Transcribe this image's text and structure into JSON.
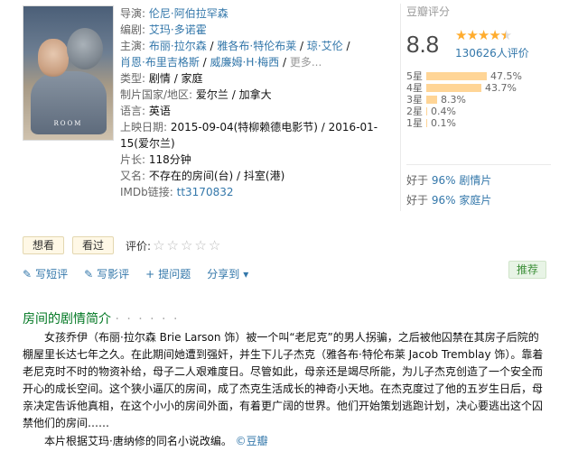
{
  "poster": {
    "title_text": "ROOM"
  },
  "info": {
    "director": {
      "label": "导演:",
      "values": [
        "伦尼·阿伯拉罕森"
      ]
    },
    "writer": {
      "label": "编剧:",
      "values": [
        "艾玛·多诺霍"
      ]
    },
    "cast": {
      "label": "主演:",
      "line1": [
        "布丽·拉尔森",
        "雅各布·特伦布莱",
        "琼·艾伦"
      ],
      "line2": [
        "肖恩·布里吉格斯",
        "威廉姆·H·梅西"
      ],
      "more": "更多..."
    },
    "genre": {
      "label": "类型:",
      "value": "剧情 / 家庭"
    },
    "country": {
      "label": "制片国家/地区:",
      "value": "爱尔兰 / 加拿大"
    },
    "language": {
      "label": "语言:",
      "value": "英语"
    },
    "release": {
      "label": "上映日期:",
      "value": "2015-09-04(特柳赖德电影节) / 2016-01-15(爱尔兰)"
    },
    "runtime": {
      "label": "片长:",
      "value": "118分钟"
    },
    "aka": {
      "label": "又名:",
      "value": "不存在的房间(台) / 抖室(港)"
    },
    "imdb": {
      "label": "IMDb链接:",
      "value": "tt3170832"
    }
  },
  "rating": {
    "title": "豆瓣评分",
    "score": "8.8",
    "stars_value": 4.5,
    "votes": "130626人评价",
    "distribution": [
      {
        "label": "5星",
        "percent": 47.5,
        "text": "47.5%"
      },
      {
        "label": "4星",
        "percent": 43.7,
        "text": "43.7%"
      },
      {
        "label": "3星",
        "percent": 8.3,
        "text": "8.3%"
      },
      {
        "label": "2星",
        "percent": 0.4,
        "text": "0.4%"
      },
      {
        "label": "1星",
        "percent": 0.1,
        "text": "0.1%"
      }
    ],
    "better_than": [
      {
        "prefix": "好于",
        "pct": "96%",
        "genre": "剧情片"
      },
      {
        "prefix": "好于",
        "pct": "96%",
        "genre": "家庭片"
      }
    ],
    "star_color": "#ffac2d",
    "bar_color": "#ffd596"
  },
  "actions": {
    "want": "想看",
    "seen": "看过",
    "rate_label": "评价:"
  },
  "ops": {
    "short_review": "写短评",
    "long_review": "写影评",
    "question": "提问题",
    "share": "分享到",
    "recommend": "推荐"
  },
  "summary": {
    "title": "房间的剧情简介",
    "dots": "· · · · · ·",
    "text": "女孩乔伊（布丽·拉尔森 Brie Larson 饰）被一个叫“老尼克”的男人拐骗，之后被他囚禁在其房子后院的棚屋里长达七年之久。在此期间她遭到强奸，并生下儿子杰克（雅各布·特伦布莱 Jacob Tremblay 饰）。靠着老尼克时不时的物资补给，母子二人艰难度日。尽管如此，母亲还是竭尽所能，为儿子杰克创造了一个安全而开心的成长空间。这个狭小逼仄的房间，成了杰克生活成长的神奇小天地。在杰克度过了他的五岁生日后，母亲决定告诉他真相，在这个小小的房间外面，有着更广阔的世界。他们开始策划逃跑计划，决心要逃出这个囚禁他们的房间……",
    "note_prefix": "本片根据艾玛·唐纳修的同名小说改编。",
    "note_source": "©豆瓣"
  },
  "colors": {
    "link": "#3377aa",
    "summary_title": "#007722"
  }
}
